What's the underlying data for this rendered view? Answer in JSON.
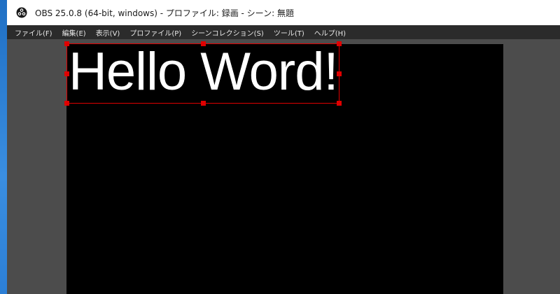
{
  "window": {
    "title": "OBS 25.0.8 (64-bit, windows) - プロファイル: 録画 - シーン: 無題",
    "app_icon": "obs-logo-icon"
  },
  "menubar": {
    "items": [
      {
        "label": "ファイル(F)"
      },
      {
        "label": "編集(E)"
      },
      {
        "label": "表示(V)"
      },
      {
        "label": "プロファイル(P)"
      },
      {
        "label": "シーンコレクション(S)"
      },
      {
        "label": "ツール(T)"
      },
      {
        "label": "ヘルプ(H)"
      }
    ]
  },
  "preview": {
    "source_text": "Hello Word!",
    "selection_color": "#e00000",
    "canvas_color": "#000000",
    "text_color": "#ffffff"
  }
}
